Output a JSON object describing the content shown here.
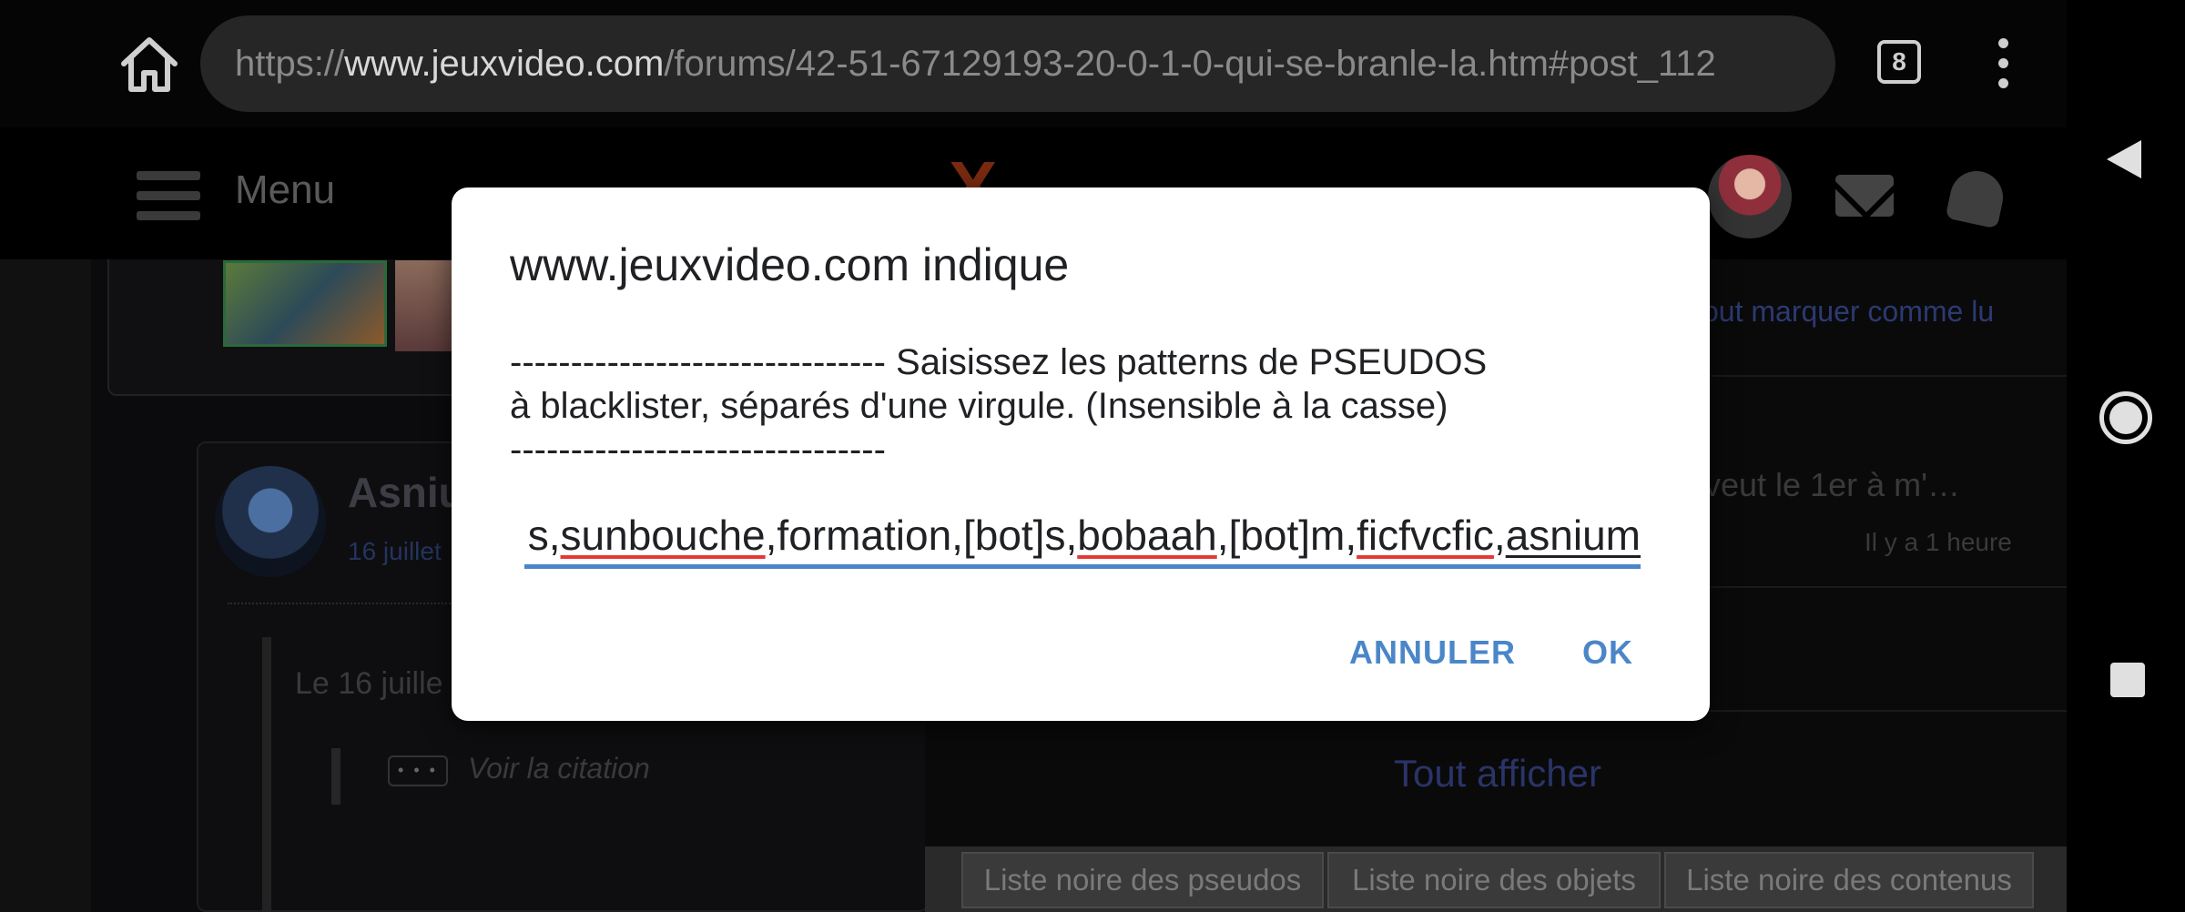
{
  "browser": {
    "url_scheme": "https://",
    "url_host": "www.jeuxvideo.com",
    "url_path": "/forums/42-51-67129193-20-0-1-0-qui-se-branle-la.htm#post_112",
    "tab_count": "8",
    "icons": [
      "home-icon",
      "tab-switcher-icon",
      "more-vert-icon"
    ]
  },
  "site": {
    "menu_label": "Menu",
    "logo": "X",
    "mark_all_read": "out marquer comme lu",
    "author_name": "Asnium",
    "author_date": "16 juillet",
    "quote_text": "Le 16 juille",
    "quote_toggle": "• • •",
    "see_quote": "Voir la citation",
    "topic_title": "veut le 1er à m'…",
    "topic_time": "Il y a 1 heure",
    "show_all": "Tout afficher",
    "blacklist_buttons": [
      "Liste noire des pseudos",
      "Liste noire des objets",
      "Liste noire des contenus"
    ]
  },
  "dialog": {
    "title": "www.jeuxvideo.com indique",
    "message_line1": "------------------------------- Saisissez les patterns de PSEUDOS",
    "message_line2": "à blacklister, séparés d'une virgule. (Insensible à la casse)",
    "message_line3": "-------------------------------",
    "input_parts": [
      {
        "t": "s,",
        "s": "plain"
      },
      {
        "t": "sunbouche",
        "s": "spell"
      },
      {
        "t": ",formation,[bot]s,",
        "s": "plain"
      },
      {
        "t": "bobaah",
        "s": "spell"
      },
      {
        "t": ",[bot]m,",
        "s": "plain"
      },
      {
        "t": "ficfvcfic",
        "s": "spell"
      },
      {
        "t": ",",
        "s": "plain"
      },
      {
        "t": "asnium",
        "s": "u"
      }
    ],
    "cancel_label": "ANNULER",
    "ok_label": "OK"
  },
  "colors": {
    "accent": "#4a86c8",
    "spellcheck": "#e53935"
  }
}
